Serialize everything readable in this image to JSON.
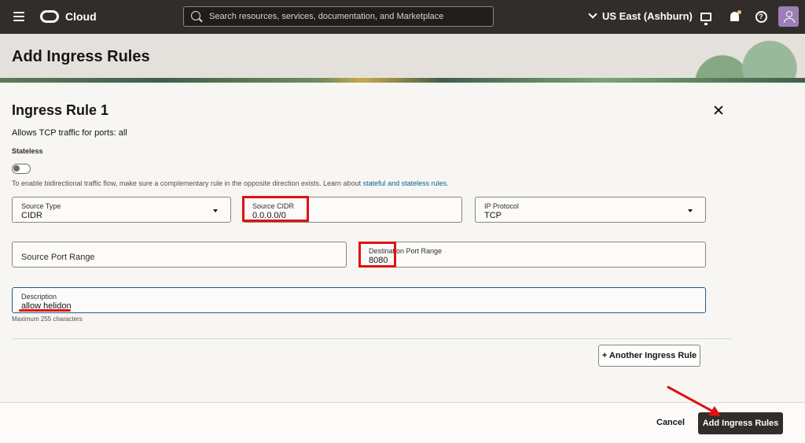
{
  "topbar": {
    "brand": "Cloud",
    "search_placeholder": "Search resources, services, documentation, and Marketplace",
    "region": "US East (Ashburn)"
  },
  "page": {
    "title": "Add Ingress Rules"
  },
  "rule": {
    "title": "Ingress Rule 1",
    "summary": "Allows TCP traffic for ports: all",
    "stateless_label": "Stateless",
    "help_text": "To enable bidirectional traffic flow, make sure a complementary rule in the opposite direction exists. Learn about ",
    "help_link": "stateful and stateless rules",
    "help_suffix": ".",
    "source_type": {
      "label": "Source Type",
      "value": "CIDR"
    },
    "source_cidr": {
      "label": "Source CIDR",
      "value": "0.0.0.0/0"
    },
    "ip_protocol": {
      "label": "IP Protocol",
      "value": "TCP"
    },
    "source_port_range": {
      "placeholder": "Source Port Range"
    },
    "destination_port_range": {
      "label": "Destination Port Range",
      "value": "8080"
    },
    "description": {
      "label": "Description",
      "value": "allow helidon"
    },
    "max_chars": "Maximum 255 characters",
    "another_button": "+ Another Ingress Rule"
  },
  "footer": {
    "cancel": "Cancel",
    "submit": "Add Ingress Rules"
  },
  "colors": {
    "annotation": "#e01111",
    "topbar": "#312d2a",
    "link": "#00688c"
  }
}
